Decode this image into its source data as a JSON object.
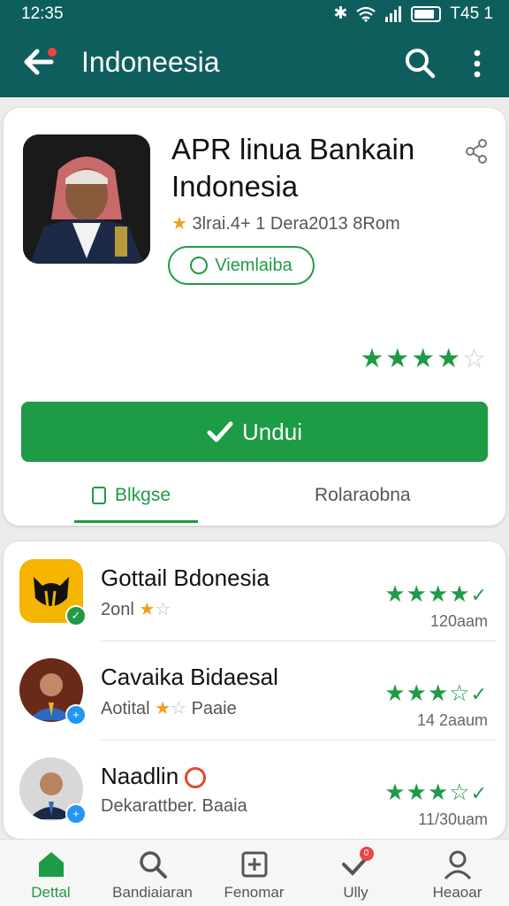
{
  "status": {
    "time": "12:35",
    "battery_text": "T45 1"
  },
  "appbar": {
    "title": "Indoneesia",
    "back_icon": "back-arrow-icon",
    "search_icon": "search-icon",
    "more_icon": "more-vert-icon"
  },
  "app": {
    "title": "APR linua Bankain Indonesia",
    "meta": "3lrai.4+ 1 Dera2013 8Rom",
    "pill_label": "Viemlaiba",
    "rating": 4,
    "install_label": "Undui",
    "tabs": [
      {
        "label": "Blkgse",
        "active": true
      },
      {
        "label": "Rolaraobna",
        "active": false
      }
    ]
  },
  "list": [
    {
      "name": "Gottail Bdonesia",
      "sub": "2onl",
      "sub_stars": 1,
      "count": "120aam",
      "rating": 4,
      "icon": "cat-logo-icon",
      "accent": "#f4b400"
    },
    {
      "name": "Cavaika Bidaesal",
      "sub": "Aotital",
      "sub_suffix": "Paaie",
      "sub_stars": 1,
      "count": "14 2aaum",
      "rating": 3,
      "icon": "person-avatar-icon",
      "accent": "#2196f3"
    },
    {
      "name": "Naadlin",
      "sub": "Dekarattber. Baaia",
      "count": "11/30uam",
      "rating": 3,
      "icon": "person-avatar-icon",
      "accent": "#2196f3"
    }
  ],
  "bottomnav": [
    {
      "label": "Dettal",
      "icon": "home-icon",
      "active": true
    },
    {
      "label": "Bandiaiaran",
      "icon": "search-icon",
      "active": false
    },
    {
      "label": "Fenomar",
      "icon": "add-box-icon",
      "active": false
    },
    {
      "label": "Ully",
      "icon": "check-icon",
      "active": false,
      "badge": "0"
    },
    {
      "label": "Heaoar",
      "icon": "person-icon",
      "active": false
    }
  ],
  "colors": {
    "teal": "#0f5e5e",
    "green": "#1e9b45",
    "star_gold": "#f0a020"
  }
}
